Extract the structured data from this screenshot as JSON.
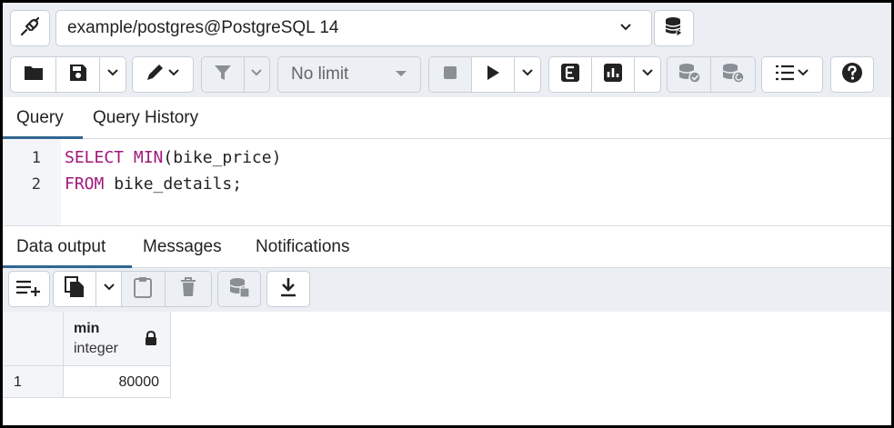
{
  "connection": {
    "label": "example/postgres@PostgreSQL 14"
  },
  "toolbar": {
    "limit_label": "No limit"
  },
  "query_tabs": [
    {
      "label": "Query",
      "active": true
    },
    {
      "label": "Query History",
      "active": false
    }
  ],
  "editor": {
    "lines": [
      {
        "number": "1",
        "keyword": "SELECT",
        "keyword2": "MIN",
        "rest": "(bike_price)"
      },
      {
        "number": "2",
        "keyword": "FROM",
        "rest": " bike_details;"
      }
    ]
  },
  "output_tabs": [
    {
      "label": "Data output",
      "active": true
    },
    {
      "label": "Messages",
      "active": false
    },
    {
      "label": "Notifications",
      "active": false
    }
  ],
  "results": {
    "columns": [
      {
        "name": "min",
        "type": "integer"
      }
    ],
    "rows": [
      {
        "row_number": "1",
        "values": [
          "80000"
        ]
      }
    ]
  },
  "colors": {
    "accent": "#326690",
    "keyword": "#a0187a",
    "toolbar_bg": "#ebeef3"
  },
  "icons": {
    "connection": "plug-icon",
    "db_status": "database-icon",
    "open_file": "folder-icon",
    "save_file": "save-icon",
    "edit": "pencil-icon",
    "filter": "filter-icon",
    "stop": "stop-icon",
    "execute": "play-icon",
    "explain": "explain-icon",
    "explain_analyze": "chart-icon",
    "commit": "db-check-icon",
    "rollback": "db-undo-icon",
    "macros": "list-icon",
    "help": "help-icon",
    "add_row": "add-row-icon",
    "copy": "copy-icon",
    "paste": "paste-icon",
    "delete": "trash-icon",
    "save_data": "save-data-icon",
    "download": "download-icon",
    "lock": "lock-icon"
  }
}
